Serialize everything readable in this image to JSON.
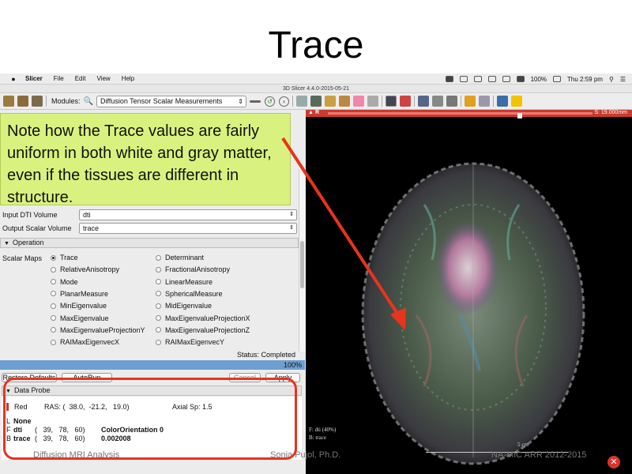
{
  "slide": {
    "title": "Trace",
    "footer_left": "Diffusion MRI Analysis",
    "footer_center": "Sonia Pujol, Ph.D.",
    "footer_right": "NA-MIC ARR 2012-2015"
  },
  "menubar": {
    "app": "Slicer",
    "items": [
      "File",
      "Edit",
      "View",
      "Help"
    ],
    "battery": "100%",
    "clock": "Thu 2:59 pm"
  },
  "window": {
    "title": "3D Slicer 4.4.0-2015-05-21"
  },
  "toolbar": {
    "modules_label": "Modules:",
    "module_selected": "Diffusion Tensor Scalar Measurements"
  },
  "callout": {
    "text": "Note how the Trace values are fairly uniform in both white and gray matter, even if the tissues are different in structure."
  },
  "io": {
    "input_label": "Input DTI Volume",
    "input_value": "dti",
    "output_label": "Output Scalar Volume",
    "output_value": "trace"
  },
  "operation": {
    "header": "Operation",
    "scalar_maps_label": "Scalar Maps",
    "left_options": [
      "Trace",
      "RelativeAnisotropy",
      "Mode",
      "PlanarMeasure",
      "MinEigenvalue",
      "MaxEigenvalue",
      "MaxEigenvalueProjectionY",
      "RAIMaxEigenvecX"
    ],
    "right_options": [
      "Determinant",
      "FractionalAnisotropy",
      "LinearMeasure",
      "SphericalMeasure",
      "MidEigenvalue",
      "MaxEigenvalueProjectionX",
      "MaxEigenvalueProjectionZ",
      "RAIMaxEigenvecY"
    ],
    "selected": "Trace"
  },
  "status": {
    "text": "Status: Completed",
    "progress_percent": 100,
    "progress_text": "100%"
  },
  "buttons": {
    "restore": "Restore Defaults",
    "autorun": "AutoRun",
    "cancel": "Cancel",
    "apply": "Apply"
  },
  "data_probe": {
    "header": "Data Probe",
    "view_name": "Red",
    "ras": "RAS: (  38.0,  -21.2,   19.0)",
    "axial": "Axial Sp: 1.5",
    "l_line_prefix": "L",
    "l_line_value": "None",
    "f_prefix": "F",
    "f_volume": "dti",
    "f_ijk": "(   39,   78,   60)",
    "f_value": "ColorOrientation 0",
    "b_prefix": "B",
    "b_volume": "trace",
    "b_ijk": "(   39,   78,   60)",
    "b_value": "0.002008"
  },
  "viewer": {
    "label": "R",
    "slice_position": "S: 19.000mm",
    "fg_annotation": "F: dti (40%)",
    "bg_annotation": "B: trace",
    "scale_label": "5 cm"
  },
  "colors": {
    "callout_bg": "#d9f27f",
    "highlight_red": "#e8341c",
    "viewer_bar": "#c93b2e",
    "progress_fill": "#6d9fd1"
  }
}
